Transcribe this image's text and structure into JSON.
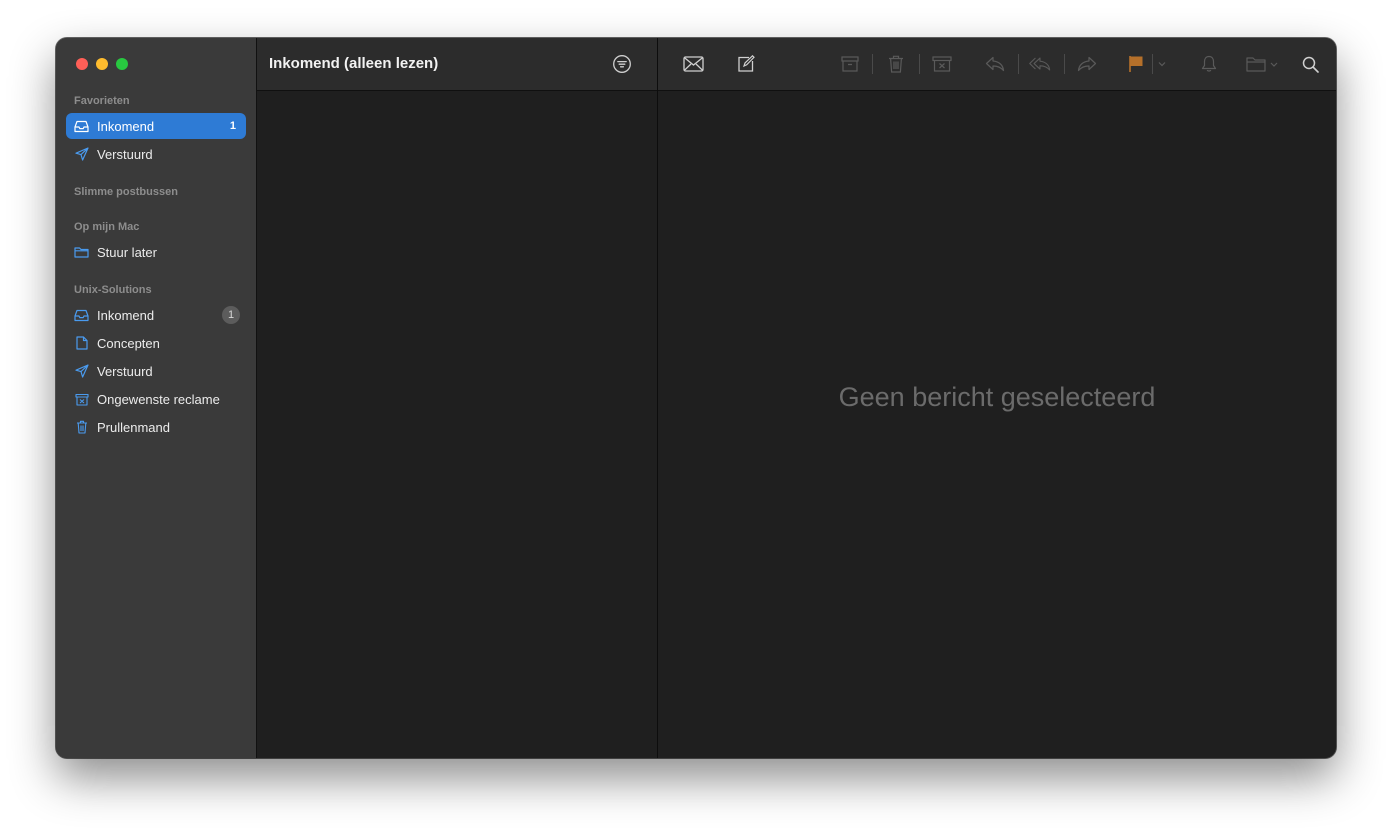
{
  "sidebar": {
    "sections": {
      "favorites": "Favorieten",
      "smart": "Slimme postbussen",
      "onmac": "Op mijn Mac",
      "account": "Unix-Solutions"
    },
    "favorites": [
      {
        "label": "Inkomend",
        "count": "1",
        "icon": "inbox-icon"
      },
      {
        "label": "Verstuurd",
        "icon": "paperplane-icon"
      }
    ],
    "onmac": [
      {
        "label": "Stuur later",
        "icon": "folder-icon"
      }
    ],
    "account": [
      {
        "label": "Inkomend",
        "count": "1",
        "icon": "inbox-icon"
      },
      {
        "label": "Concepten",
        "icon": "document-icon"
      },
      {
        "label": "Verstuurd",
        "icon": "paperplane-icon"
      },
      {
        "label": "Ongewenste reclame",
        "icon": "junk-icon"
      },
      {
        "label": "Prullenmand",
        "icon": "trash-icon"
      }
    ]
  },
  "list": {
    "title": "Inkomend (alleen lezen)"
  },
  "reader": {
    "empty_message": "Geen bericht geselecteerd"
  },
  "colors": {
    "accent": "#2e7bd5",
    "flag": "#b5702a",
    "sidebar_icon": "#4a9bef"
  }
}
